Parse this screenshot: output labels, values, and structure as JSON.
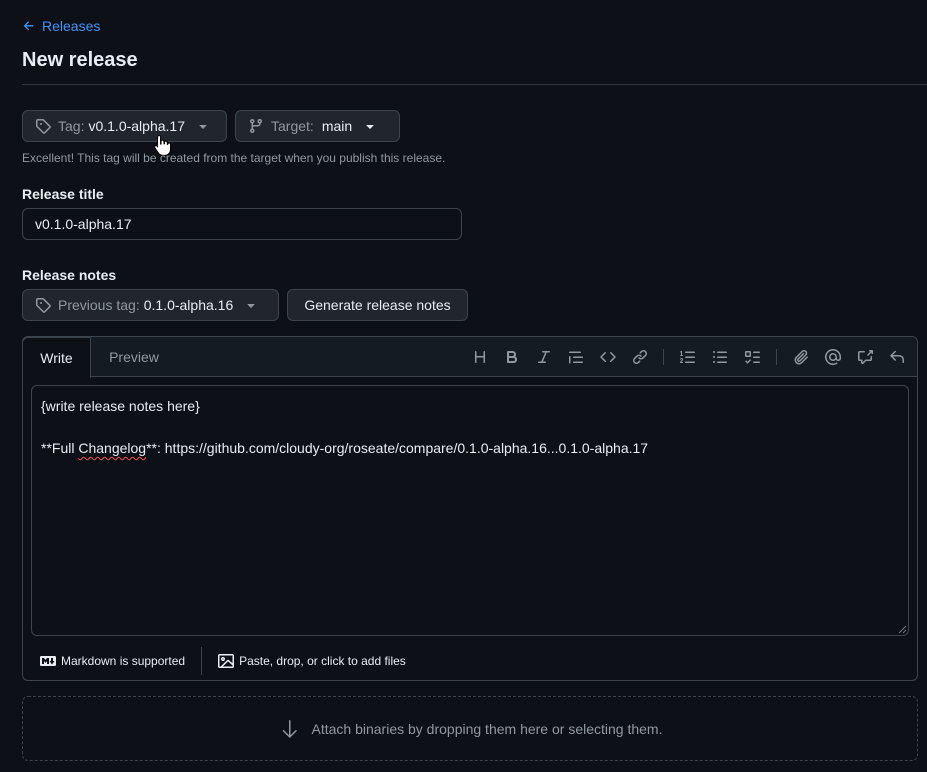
{
  "nav": {
    "back_label": "Releases"
  },
  "page": {
    "title": "New release"
  },
  "tag_picker": {
    "prefix": "Tag:",
    "value": "v0.1.0-alpha.17"
  },
  "target_picker": {
    "prefix": "Target:",
    "value": "main"
  },
  "tag_hint": "Excellent! This tag will be created from the target when you publish this release.",
  "release_title": {
    "label": "Release title",
    "value": "v0.1.0-alpha.17"
  },
  "release_notes": {
    "label": "Release notes",
    "previous_tag": {
      "prefix": "Previous tag:",
      "value": "0.1.0-alpha.16"
    },
    "generate_label": "Generate release notes"
  },
  "editor": {
    "tabs": {
      "write": "Write",
      "preview": "Preview"
    },
    "toolbar_icons": [
      "heading-icon",
      "bold-icon",
      "italic-icon",
      "quote-icon",
      "code-icon",
      "link-icon",
      "ordered-list-icon",
      "unordered-list-icon",
      "task-list-icon",
      "attach-icon",
      "mention-icon",
      "reference-icon",
      "undo-icon"
    ],
    "content": {
      "line1": "{write release notes here}",
      "line3_pre": "**Full ",
      "line3_word": "Changelog",
      "line3_post": "**: https://github.com/cloudy-org/roseate/compare/0.1.0-alpha.16...0.1.0-alpha.17"
    },
    "footer": {
      "markdown": "Markdown is supported",
      "attach": "Paste, drop, or click to add files"
    }
  },
  "dropzone": {
    "text": "Attach binaries by dropping them here or selecting them."
  },
  "colors": {
    "background": "#0d1117",
    "accent_link": "#4493f8",
    "border": "#3d444d",
    "button": "#21262d"
  }
}
